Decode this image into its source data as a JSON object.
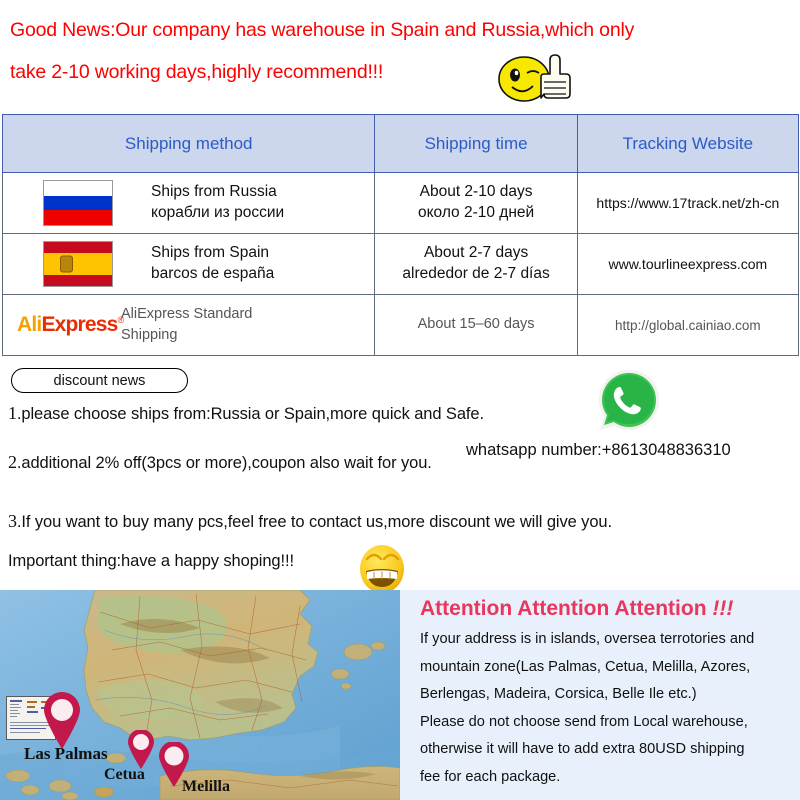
{
  "banner": {
    "line1": "Good News:Our company has warehouse in Spain and Russia,which only",
    "line2": "take 2-10 working days,highly recommend!!!",
    "emoji": "thumbs-up-wink-smiley",
    "color": "#ff0000"
  },
  "table": {
    "header_bg": "#ccd6ec",
    "header_text_color": "#2b5cc6",
    "columns": [
      "Shipping method",
      "Shipping time",
      "Tracking Website"
    ],
    "rows": [
      {
        "flag": "russia-flag",
        "method_line1": "Ships from Russia",
        "method_line2": "корабли из россии",
        "time_line1": "About 2-10 days",
        "time_line2": "около 2-10 дней",
        "site": "https://www.17track.net/zh-cn"
      },
      {
        "flag": "spain-flag",
        "method_line1": "Ships from Spain",
        "method_line2": "barcos de españa",
        "time_line1": "About 2-7 days",
        "time_line2": "alrededor de 2-7 días",
        "site": "www.tourlineexpress.com"
      },
      {
        "flag": "aliexpress-logo",
        "logo_part1": "Ali",
        "logo_part2": "Express",
        "method_line1": "AliExpress Standard",
        "method_line2": "Shipping",
        "time_line1": "About 15–60 days",
        "time_line2": "",
        "site": "http://global.cainiao.com"
      }
    ]
  },
  "discount": {
    "badge": "discount news",
    "item1_num": "1",
    "item1": ".please choose ships from:Russia or Spain,more quick and Safe.",
    "item2_num": "2",
    "item2": ".additional 2% off(3pcs or more),coupon also wait for you.",
    "item3_num": "3",
    "item3": ".If you want to buy many pcs,feel free to contact us,more discount we will give you.",
    "item4": "Important thing:have a happy shoping!!!",
    "whatsapp_icon": "whatsapp-logo",
    "whatsapp_number": "whatsapp number:+8613048836310",
    "grin_emoji": "grinning-smiley"
  },
  "map": {
    "pins": [
      "Las Palmas",
      "Cetua",
      "Melilla"
    ],
    "pin_color": "#c2184b"
  },
  "attention": {
    "title": "Attention Attention Attention ",
    "title_bang": "!!!",
    "title_color": "#e8365d",
    "bg": "#e7f0fb",
    "lines": [
      "If your address is in islands, oversea terrotories and",
      "mountain zone(Las Palmas, Cetua, Melilla, Azores,",
      "Berlengas, Madeira, Corsica, Belle Ile etc.)",
      "Please do not choose send from Local warehouse,",
      "otherwise it will have to add extra 80USD shipping",
      "fee for each package."
    ]
  }
}
